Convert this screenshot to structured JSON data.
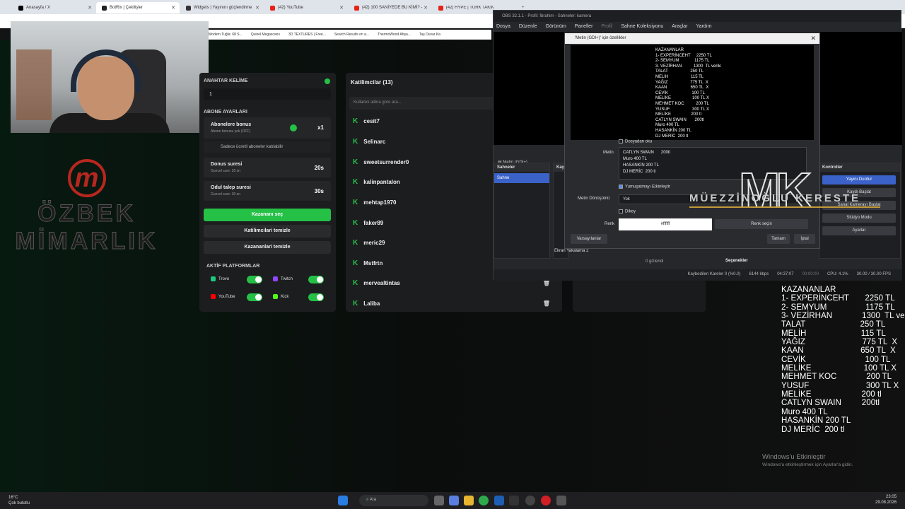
{
  "browser": {
    "tabs": [
      {
        "label": "Anasayfa / X",
        "color": "#000000"
      },
      {
        "label": "BotRix | Çekilişler",
        "color": "#222222"
      },
      {
        "label": "Widgets | Yayınını güçlendirme",
        "color": "#333333"
      },
      {
        "label": "(42) YouTube",
        "color": "#e62117"
      },
      {
        "label": "(42) 100 SANİYEDE BU KİMİ? - ",
        "color": "#e62117"
      },
      {
        "label": "(42) HYPE | TÜRK TAKIMLARININ",
        "color": "#e62117"
      }
    ],
    "bookmarks": [
      "Modern Tuğla: 68 S...",
      "Quixel Megascans",
      "3D TEXTURES | Free...",
      "Search Results on a...",
      "ThermoWood Ahşa...",
      "Taş Duvar Ka"
    ]
  },
  "logo": {
    "letter": "m",
    "line1": "ÖZBEK",
    "line2": "MİMARLIK"
  },
  "giveaway": {
    "keyword_title": "ANAHTAR KELİME",
    "keyword_value": "1",
    "sub_settings_title": "ABONE AYARLARI",
    "sub_bonus_label": "Abonelere bonus",
    "sub_bonus_sub": "Abone bonusu yok (OFF)",
    "sub_bonus_value": "x1",
    "sub_only_label": "Sadece ücretli aboneler katılabilir",
    "spin_label": "Donus suresi",
    "spin_sub": "Guncel sure: 20 sn",
    "spin_value": "20s",
    "claim_label": "Odul talep suresi",
    "claim_sub": "Guncel sure: 30 sn",
    "claim_value": "30s",
    "pick_winner": "Kazananı seç",
    "clear_participants": "Katilimcilari temizle",
    "clear_winners": "Kazananlari temizle",
    "platforms_title": "AKTİF PLATFORMLAR",
    "platforms": [
      {
        "name": "Trovo",
        "color": "#1fc77e"
      },
      {
        "name": "Twitch",
        "color": "#9146ff"
      },
      {
        "name": "YouTube",
        "color": "#ff0000"
      },
      {
        "name": "Kick",
        "color": "#53fc18"
      }
    ]
  },
  "participants": {
    "title": "Katilimcilar (13)",
    "search_placeholder": "Kullanici adina gore ara...",
    "list": [
      "cesit7",
      "Selinarc",
      "sweetsurrender0",
      "kalinpantalon",
      "mehtap1970",
      "faker89",
      "meric29",
      "Mstfrtn",
      "mervealtintas",
      "Laliba"
    ]
  },
  "obs": {
    "title": "OBS 32.1.1 - Profil: İbrahim - Sahneler: kamera",
    "menu": [
      "Dosya",
      "Düzenle",
      "Görünüm",
      "Paneller",
      "Profil",
      "Sahne Koleksiyonu",
      "Araçlar",
      "Yardım"
    ],
    "source_label": "Metin (GDI+)",
    "scenes_title": "Sahneler",
    "scene_active": "Sahne",
    "sources_title": "Kayna",
    "source_item": "Ekran Yakalama 2",
    "controls_title": "Kontroller",
    "controls": [
      "Yayını Durdur",
      "Kaydı Başlat",
      "Sanal Kamerayı Başlat",
      "Stüdyo Modu",
      "Ayarlar"
    ],
    "mixer_text": "0 gizlendi",
    "options": "Seçenekler",
    "status": {
      "dropped": "Kaybedilen Kareler 0 (%0.0)",
      "kbps": "6144 kbps",
      "live": "04:37:07",
      "rec": "00:00:00",
      "cpu": "CPU: 4.1%",
      "fps": "30.00 / 30.00 FPS"
    }
  },
  "dialog": {
    "title": "'Metin (GDI+)' için özellikler",
    "preview_text": "KAZANANLAR\n1- EXPERİNCEHT     2250 TL\n2- SEMYUM             1175 TL\n3- VEZİRHAN          1300  TL verilc\nTALAT                   250 TL\nMELİH                   115 TL\nYAĞIZ                   775 TL  X\nKAAN                    650 TL  X\nCEVİK                    100 TL\nMELİKE                  100 TL X\nMEHMET KOC          200 TL\nYUSUF                   300 TL X\nMELİKE                 200 tl\nCATLYN SWAIN       200tl\nMuro 400 TL\nHASANKİN 200 TL\nDJ MERİC  200 tl",
    "read_file": "Dosyadan oku",
    "text_label": "Metin",
    "text_value": "CATLYN SWAIN      200tl\nMuro 400 TL\nHASANKİN 200 TL\nDJ MERİC  200 tl",
    "antialias": "Yumuşatmayı Etkinleştir",
    "transform_label": "Metin Dönüşümü",
    "transform_value": "Yok",
    "vertical": "Dikey",
    "color_label": "Renk",
    "color_value": "#ffffff",
    "pick_color": "Renk seçin",
    "defaults": "Varsayılanlar",
    "ok": "Tamam",
    "cancel": "İptal"
  },
  "watermark": {
    "mark": "MK",
    "name": "MÜEZZİNOĞLU KERESTE"
  },
  "winners_text": "KAZANANLAR\n1- EXPERİNCEHT       2250 TL\n2- SEMYUM                 1175 TL\n3- VEZİRHAN             1300  TL verilc\nTALAT                        250 TL\nMELİH                        115 TL\nYAĞIZ                         775 TL  X\nKAAN                         650 TL  X\nCEVİK                          100 TL\nMELİKE                       100 TL X\nMEHMET KOC             200 TL\nYUSUF                         300 TL X\nMELİKE                      200 tl\nCATLYN SWAIN         200tl\nMuro 400 TL\nHASANKİN 200 TL\nDJ MERİC  200 tl",
  "activation": {
    "title": "Windows'u Etkinleştir",
    "sub": "Windows'u etkinleştirmek için Ayarlar'a gidin."
  },
  "taskbar": {
    "temp": "16°C",
    "weather": "Çok bulutlu",
    "search": "Ara",
    "time": "23:05",
    "date": "29.08.2026"
  }
}
